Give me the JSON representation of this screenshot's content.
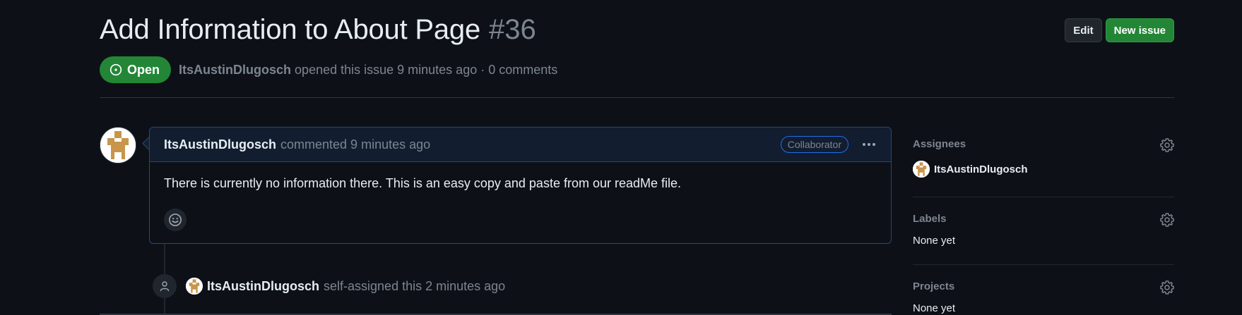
{
  "issue": {
    "title": "Add Information to About Page",
    "number": "#36",
    "state": "Open",
    "author": "ItsAustinDlugosch",
    "meta_rest": "opened this issue 9 minutes ago · 0 comments"
  },
  "header_actions": {
    "edit_label": "Edit",
    "new_issue_label": "New issue"
  },
  "comment": {
    "author": "ItsAustinDlugosch",
    "action": "commented 9 minutes ago",
    "badge": "Collaborator",
    "body": "There is currently no information there. This is an easy copy and paste from our readMe file."
  },
  "timeline": {
    "author": "ItsAustinDlugosch",
    "action": "self-assigned this 2 minutes ago"
  },
  "sidebar": {
    "assignees": {
      "heading": "Assignees",
      "value": "ItsAustinDlugosch"
    },
    "labels": {
      "heading": "Labels",
      "value": "None yet"
    },
    "projects": {
      "heading": "Projects",
      "value": "None yet"
    }
  },
  "colors": {
    "background": "#0d1117",
    "open_green": "#238636",
    "accent_border": "#1f4a7a",
    "muted_text": "#7d8590"
  },
  "icons": {
    "state": "issue-opened-icon",
    "menu": "kebab-horizontal-icon",
    "reaction": "smiley-icon",
    "timeline": "person-icon",
    "settings": "gear-icon"
  }
}
